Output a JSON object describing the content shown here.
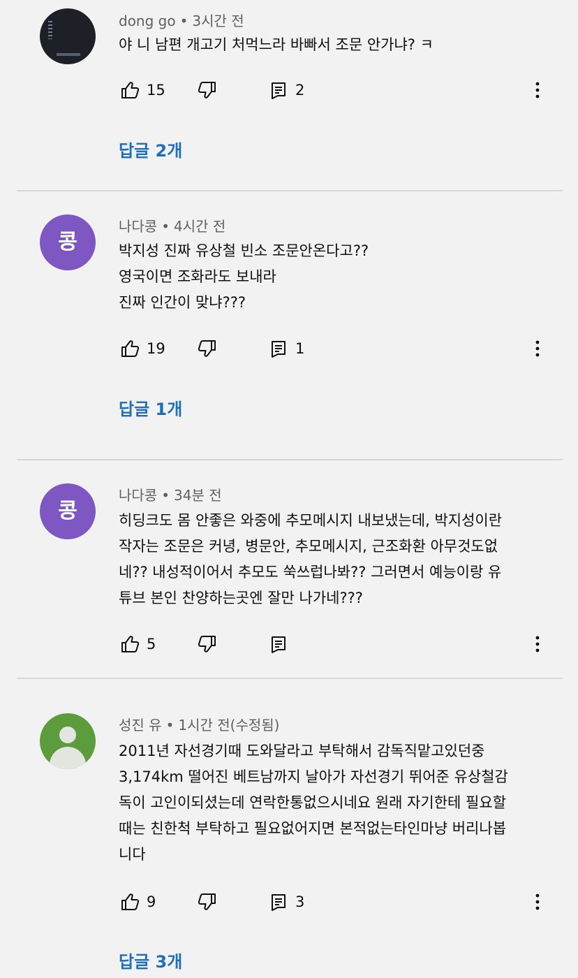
{
  "comments": [
    {
      "author": "dong go",
      "time": "3시간 전",
      "lines": [
        "야 니 남편 개고기 처먹느라 바빠서 조문 안가냐? ㅋ"
      ],
      "likes": "15",
      "reply_count": "2",
      "replies_label": "답글 2개"
    },
    {
      "author": "나다콩",
      "avatar_letter": "콩",
      "time": "4시간 전",
      "lines": [
        "박지성 진짜 유상철 빈소 조문안온다고??",
        "영국이면 조화라도 보내라",
        "진짜 인간이 맞냐???"
      ],
      "likes": "19",
      "reply_count": "1",
      "replies_label": "답글 1개"
    },
    {
      "author": "나다콩",
      "avatar_letter": "콩",
      "time": "34분 전",
      "lines": [
        "히딩크도 몸 안좋은 와중에 추모메시지 내보냈는데,  박지성이란",
        "작자는 조문은 커녕, 병문안, 추모메시지, 근조화환  아무것도없",
        "네??  내성적이어서 추모도 쑥쓰럽나봐??  그러면서 예능이랑 유",
        "튜브 본인 찬양하는곳엔 잘만 나가네???"
      ],
      "likes": "5",
      "reply_count": ""
    },
    {
      "author": "성진 유",
      "time": "1시간 전(수정됨)",
      "lines": [
        "2011년 자선경기때 도와달라고 부탁해서 감독직맡고있던중",
        "3,174km 떨어진 베트남까지 날아가 자선경기 뛰어준 유상철감",
        "독이 고인이되셨는데 연락한통없으시네요 원래 자기한테 필요할",
        "때는 친한척 부탁하고 필요없어지면 본적없는타인마냥 버리나봅",
        "니다"
      ],
      "likes": "9",
      "reply_count": "3",
      "replies_label": "답글 3개"
    }
  ],
  "separator": "•",
  "icons": {
    "like": "thumb-up-icon",
    "dislike": "thumb-down-icon",
    "reply": "comment-reply-icon",
    "more": "more-vert-icon"
  }
}
